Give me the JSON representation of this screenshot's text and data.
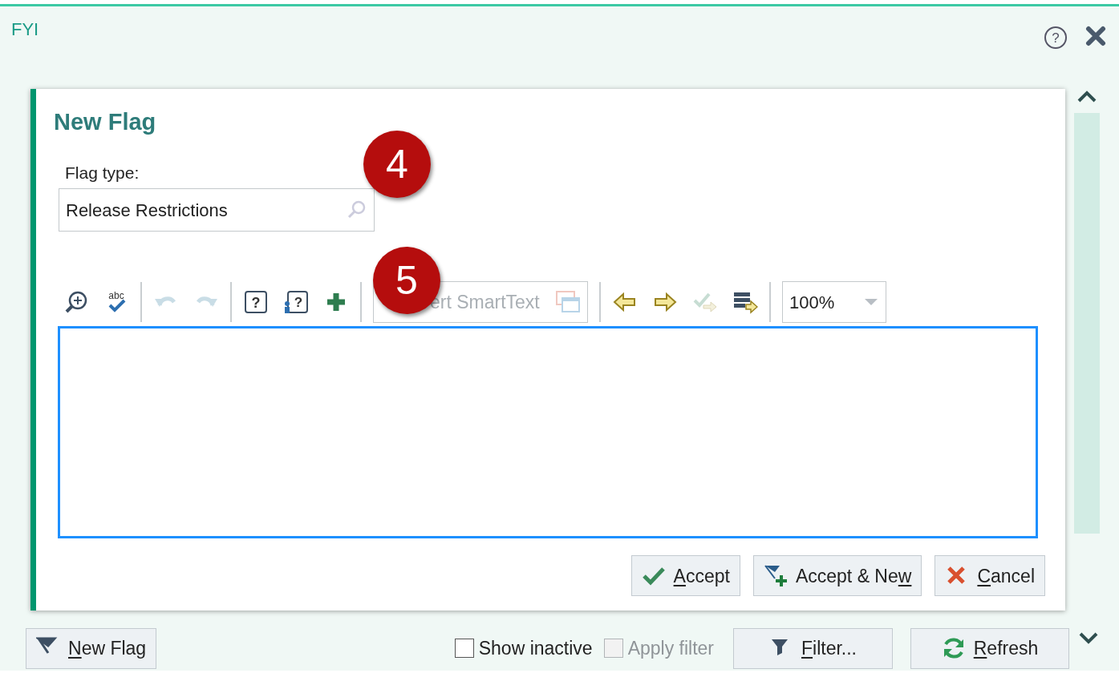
{
  "panel": {
    "title": "FYI",
    "help_glyph": "?"
  },
  "new_flag": {
    "title": "New Flag",
    "flag_type": {
      "label": "Flag type:",
      "value": "Release Restrictions"
    },
    "tool_groups": [
      [
        {
          "disabled": false
        },
        {
          "disabled": false,
          "glyph": "abc"
        }
      ],
      [
        {
          "disabled": true
        },
        {
          "disabled": true
        }
      ],
      [
        {
          "disabled": false,
          "glyph": "?"
        },
        {
          "disabled": false,
          "glyph": "?"
        },
        {
          "disabled": false
        }
      ],
      [
        {
          "disabled": false
        },
        {
          "disabled": false
        },
        {
          "disabled": true
        },
        {
          "disabled": false
        }
      ]
    ],
    "smarttext_field": {
      "placeholder": "ert SmartText"
    },
    "zoom_select": {
      "value": "100%"
    },
    "buttons": [
      {
        "kind": "accept",
        "mnemonic": "A",
        "after": "ccept"
      },
      {
        "kind": "accept-new",
        "before": "Accept & Ne",
        "mnemonic": "w"
      },
      {
        "kind": "cancel",
        "mnemonic": "C",
        "after": "ancel"
      }
    ]
  },
  "callouts": [
    {
      "number": "4"
    },
    {
      "number": "5"
    }
  ],
  "footer": {
    "new_flag_button": {
      "mnemonic": "N",
      "after": "ew Flag"
    },
    "checkboxes": [
      {
        "label": "Show inactive",
        "checked": false,
        "disabled": false
      },
      {
        "label": "Apply filter",
        "checked": false,
        "disabled": true
      }
    ],
    "buttons": [
      {
        "kind": "filter",
        "mnemonic": "F",
        "after": "ilter..."
      },
      {
        "kind": "refresh",
        "mnemonic": "R",
        "after": "efresh"
      }
    ]
  }
}
